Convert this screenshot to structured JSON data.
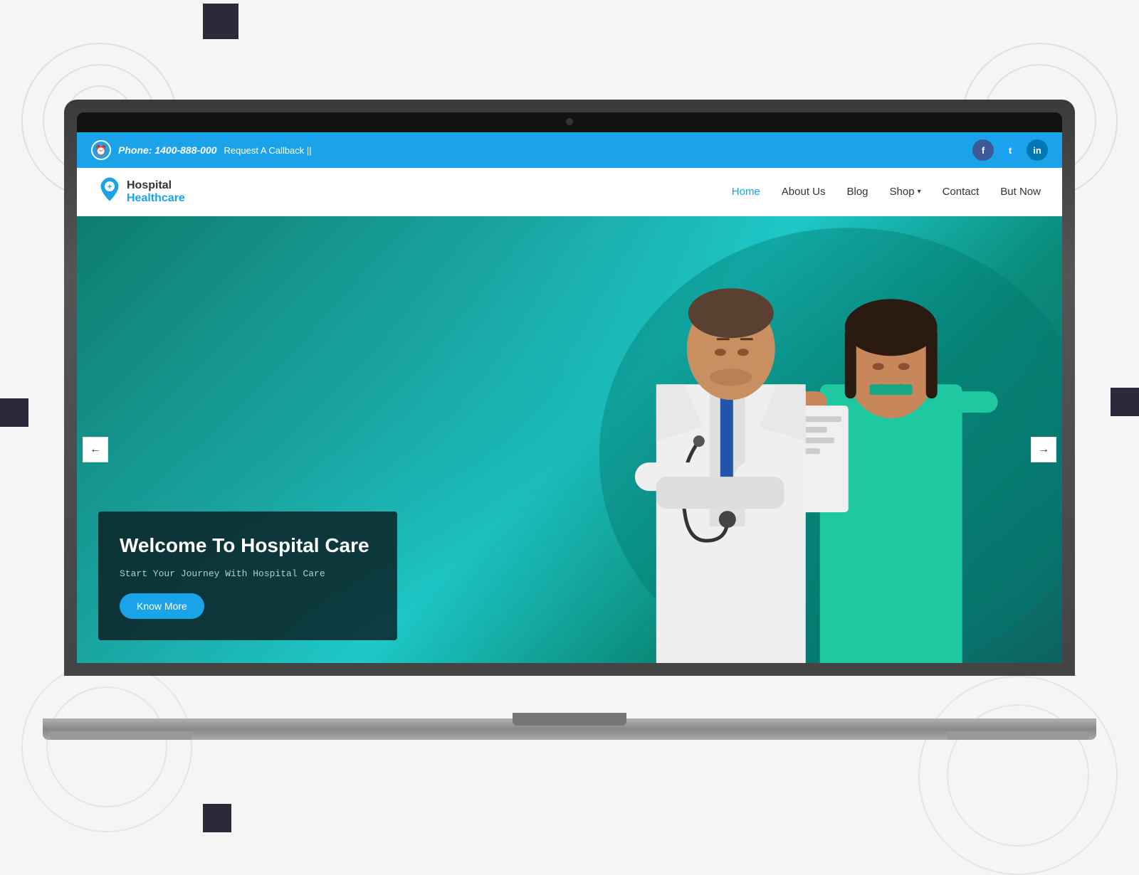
{
  "background": {
    "color": "#f0f0f0"
  },
  "topbar": {
    "phone_label": "Phone:",
    "phone_number": "1400-888-000",
    "callback_text": "Request A Callback ||",
    "social": [
      {
        "label": "f",
        "name": "facebook",
        "color": "#3b5998"
      },
      {
        "label": "t",
        "name": "twitter",
        "color": "#1da1f2"
      },
      {
        "label": "in",
        "name": "linkedin",
        "color": "#0077b5"
      }
    ]
  },
  "navbar": {
    "logo_line1": "Hospital",
    "logo_line2": "Healthcare",
    "links": [
      {
        "label": "Home",
        "active": true
      },
      {
        "label": "About Us",
        "active": false
      },
      {
        "label": "Blog",
        "active": false
      },
      {
        "label": "Shop",
        "active": false,
        "has_dropdown": true
      },
      {
        "label": "Contact",
        "active": false
      },
      {
        "label": "But Now",
        "active": false
      }
    ]
  },
  "hero": {
    "title": "Welcome To Hospital Care",
    "subtitle": "Start Your Journey With Hospital Care",
    "cta_label": "Know More",
    "arrow_left": "←",
    "arrow_right": "→"
  }
}
